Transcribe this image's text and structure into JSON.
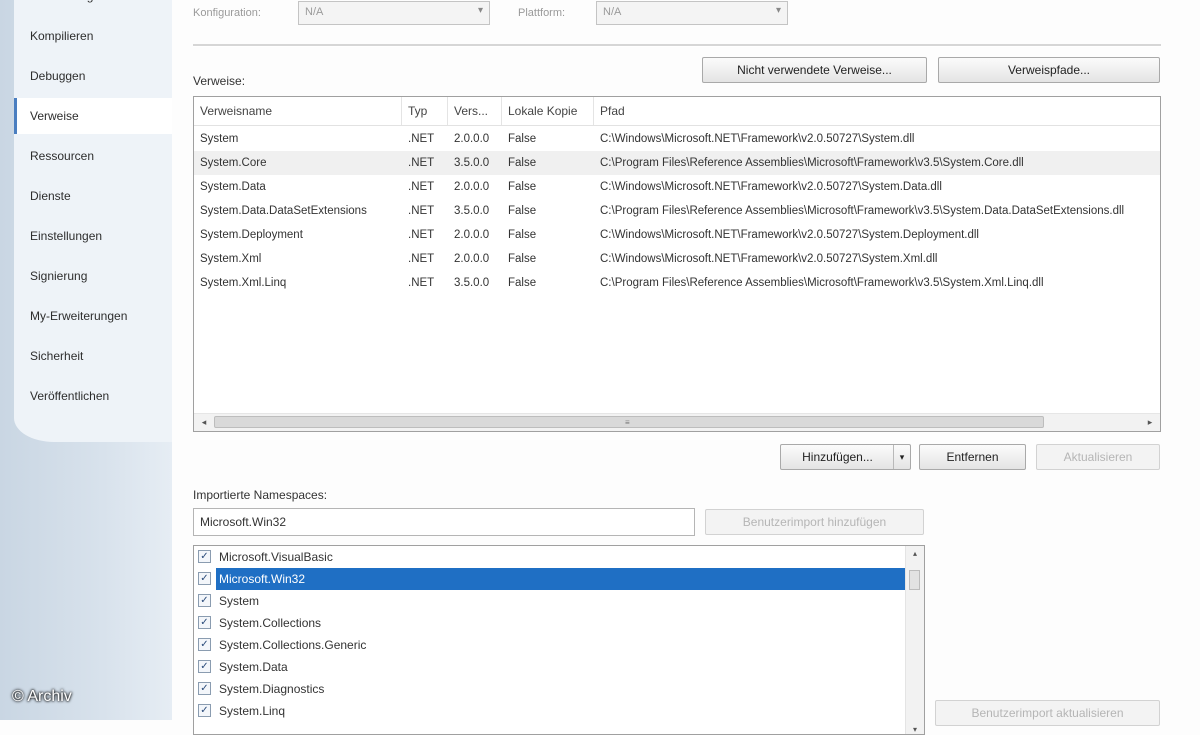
{
  "sidebar": {
    "items": [
      {
        "label": "Anwendung"
      },
      {
        "label": "Kompilieren"
      },
      {
        "label": "Debuggen"
      },
      {
        "label": "Verweise",
        "active": true
      },
      {
        "label": "Ressourcen"
      },
      {
        "label": "Dienste"
      },
      {
        "label": "Einstellungen"
      },
      {
        "label": "Signierung"
      },
      {
        "label": "My-Erweiterungen"
      },
      {
        "label": "Sicherheit"
      },
      {
        "label": "Veröffentlichen"
      }
    ]
  },
  "config": {
    "configuration_label": "Konfiguration:",
    "configuration_value": "N/A",
    "platform_label": "Plattform:",
    "platform_value": "N/A"
  },
  "references": {
    "label": "Verweise:",
    "unused_button": "Nicht verwendete Verweise...",
    "paths_button": "Verweispfade...",
    "columns": [
      "Verweisname",
      "Typ",
      "Vers...",
      "Lokale Kopie",
      "Pfad"
    ],
    "rows": [
      [
        "System",
        ".NET",
        "2.0.0.0",
        "False",
        "C:\\Windows\\Microsoft.NET\\Framework\\v2.0.50727\\System.dll"
      ],
      [
        "System.Core",
        ".NET",
        "3.5.0.0",
        "False",
        "C:\\Program Files\\Reference Assemblies\\Microsoft\\Framework\\v3.5\\System.Core.dll"
      ],
      [
        "System.Data",
        ".NET",
        "2.0.0.0",
        "False",
        "C:\\Windows\\Microsoft.NET\\Framework\\v2.0.50727\\System.Data.dll"
      ],
      [
        "System.Data.DataSetExtensions",
        ".NET",
        "3.5.0.0",
        "False",
        "C:\\Program Files\\Reference Assemblies\\Microsoft\\Framework\\v3.5\\System.Data.DataSetExtensions.dll"
      ],
      [
        "System.Deployment",
        ".NET",
        "2.0.0.0",
        "False",
        "C:\\Windows\\Microsoft.NET\\Framework\\v2.0.50727\\System.Deployment.dll"
      ],
      [
        "System.Xml",
        ".NET",
        "2.0.0.0",
        "False",
        "C:\\Windows\\Microsoft.NET\\Framework\\v2.0.50727\\System.Xml.dll"
      ],
      [
        "System.Xml.Linq",
        ".NET",
        "3.5.0.0",
        "False",
        "C:\\Program Files\\Reference Assemblies\\Microsoft\\Framework\\v3.5\\System.Xml.Linq.dll"
      ]
    ],
    "add_button": "Hinzufügen...",
    "remove_button": "Entfernen",
    "update_button": "Aktualisieren"
  },
  "namespaces": {
    "label": "Importierte Namespaces:",
    "input_value": "Microsoft.Win32",
    "add_user_import_button": "Benutzerimport hinzufügen",
    "items": [
      {
        "label": "Microsoft.VisualBasic",
        "checked": true
      },
      {
        "label": "Microsoft.Win32",
        "checked": true,
        "selected": true
      },
      {
        "label": "System",
        "checked": true
      },
      {
        "label": "System.Collections",
        "checked": true
      },
      {
        "label": "System.Collections.Generic",
        "checked": true
      },
      {
        "label": "System.Data",
        "checked": true
      },
      {
        "label": "System.Diagnostics",
        "checked": true
      },
      {
        "label": "System.Linq",
        "checked": true
      }
    ],
    "update_user_import_button": "Benutzerimport aktualisieren"
  },
  "watermark": "© Archiv"
}
